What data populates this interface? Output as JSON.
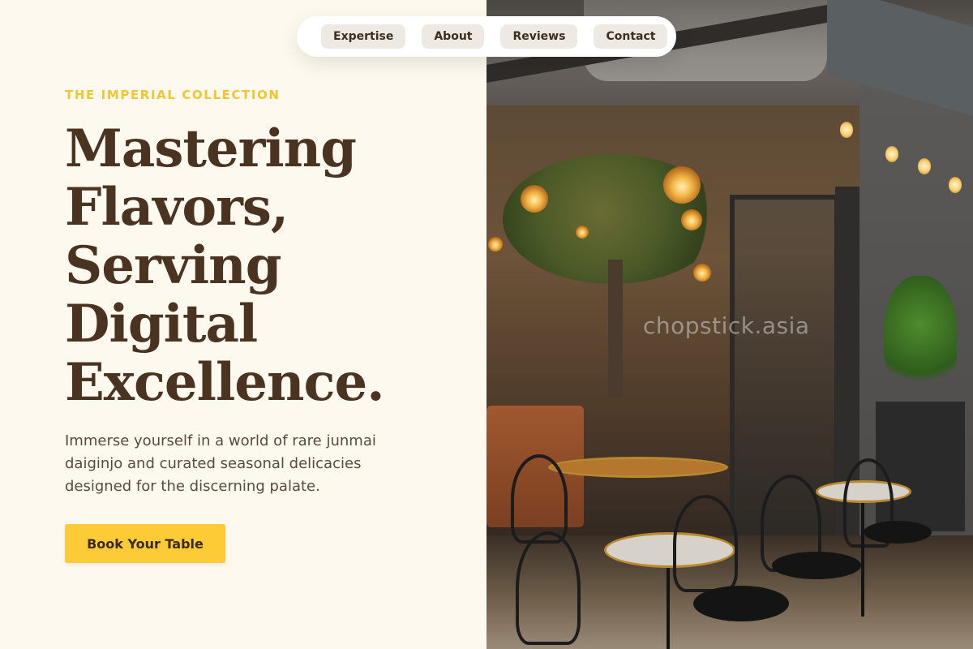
{
  "nav": {
    "items": [
      {
        "label": "Expertise"
      },
      {
        "label": "About"
      },
      {
        "label": "Reviews"
      },
      {
        "label": "Contact"
      }
    ]
  },
  "hero": {
    "eyebrow": "THE IMPERIAL COLLECTION",
    "headline_lines": [
      "Mastering",
      "Flavors,",
      "Serving",
      "Digital",
      "Excellence."
    ],
    "description": "Immerse yourself in a world of rare junmai daiginjo and curated seasonal delicacies designed for the discerning palate.",
    "cta_label": "Book Your Table"
  },
  "photo": {
    "watermark": "chopstick.asia"
  },
  "colors": {
    "background": "#fdf9ee",
    "accent": "#f3c531",
    "button": "#fccb36",
    "headline": "#4b3322",
    "body_text": "#5a4a3c"
  }
}
